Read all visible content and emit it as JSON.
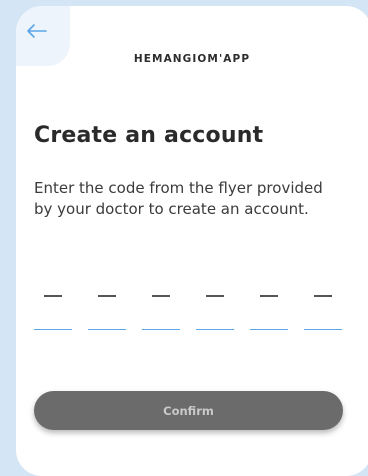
{
  "header": {
    "back_icon": "arrow-left-icon",
    "app_name": "HEMANGIOM'APP"
  },
  "main": {
    "title": "Create an account",
    "instructions": "Enter the code from the flyer provided by your doctor to create an account.",
    "code_length": 6,
    "code_values": [
      "",
      "",
      "",
      "",
      "",
      ""
    ]
  },
  "actions": {
    "confirm_label": "Confirm"
  },
  "colors": {
    "background": "#d4e6f6",
    "accent": "#5aa6e8",
    "button": "#6b6b6b",
    "button_text": "#c9c9c9"
  }
}
